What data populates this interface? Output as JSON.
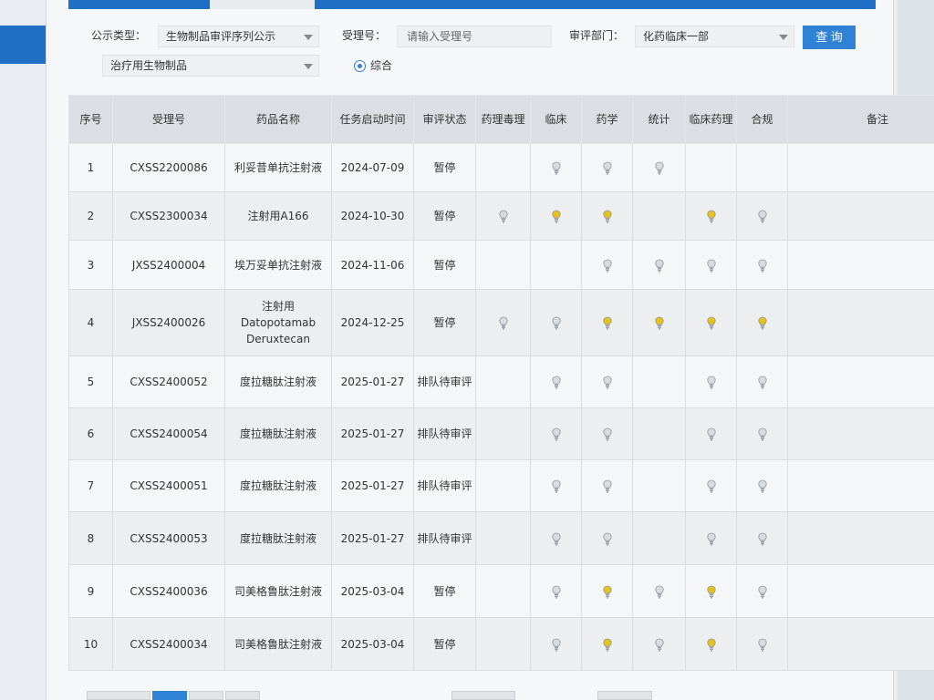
{
  "filters": {
    "type_label": "公示类型：",
    "type_value": "生物制品审评序列公示",
    "accept_label": "受理号：",
    "accept_placeholder": "请输入受理号",
    "dept_label": "审评部门：",
    "dept_value": "化药临床一部",
    "query_button": "查 询",
    "category_value": "治疗用生物制品",
    "radio_label": "综合"
  },
  "table": {
    "headers": [
      "序号",
      "受理号",
      "药品名称",
      "任务启动时间",
      "审评状态",
      "药理毒理",
      "临床",
      "药学",
      "统计",
      "临床药理",
      "合规",
      "备注"
    ],
    "rows": [
      {
        "no": "1",
        "id": "CXSS2200086",
        "name": "利妥昔单抗注射液",
        "date": "2024-07-09",
        "status": "暂停",
        "cells": [
          "",
          "off",
          "off",
          "off",
          "",
          "",
          ""
        ]
      },
      {
        "no": "2",
        "id": "CXSS2300034",
        "name": "注射用A166",
        "date": "2024-10-30",
        "status": "暂停",
        "cells": [
          "off",
          "on",
          "on",
          "",
          "on",
          "off",
          ""
        ]
      },
      {
        "no": "3",
        "id": "JXSS2400004",
        "name": "埃万妥单抗注射液",
        "date": "2024-11-06",
        "status": "暂停",
        "cells": [
          "",
          "",
          "off",
          "off",
          "off",
          "off",
          ""
        ]
      },
      {
        "no": "4",
        "id": "JXSS2400026",
        "name": "注射用 Datopotamab Deruxtecan",
        "date": "2024-12-25",
        "status": "暂停",
        "cells": [
          "off",
          "off",
          "on",
          "on",
          "on",
          "on",
          ""
        ]
      },
      {
        "no": "5",
        "id": "CXSS2400052",
        "name": "度拉糖肽注射液",
        "date": "2025-01-27",
        "status": "排队待审评",
        "cells": [
          "",
          "off",
          "off",
          "",
          "off",
          "off",
          ""
        ]
      },
      {
        "no": "6",
        "id": "CXSS2400054",
        "name": "度拉糖肽注射液",
        "date": "2025-01-27",
        "status": "排队待审评",
        "cells": [
          "",
          "off",
          "off",
          "",
          "off",
          "off",
          ""
        ]
      },
      {
        "no": "7",
        "id": "CXSS2400051",
        "name": "度拉糖肽注射液",
        "date": "2025-01-27",
        "status": "排队待审评",
        "cells": [
          "",
          "off",
          "off",
          "",
          "off",
          "off",
          ""
        ]
      },
      {
        "no": "8",
        "id": "CXSS2400053",
        "name": "度拉糖肽注射液",
        "date": "2025-01-27",
        "status": "排队待审评",
        "cells": [
          "",
          "off",
          "off",
          "",
          "off",
          "off",
          ""
        ]
      },
      {
        "no": "9",
        "id": "CXSS2400036",
        "name": "司美格鲁肽注射液",
        "date": "2025-03-04",
        "status": "暂停",
        "cells": [
          "",
          "off",
          "on",
          "off",
          "on",
          "off",
          ""
        ]
      },
      {
        "no": "10",
        "id": "CXSS2400034",
        "name": "司美格鲁肽注射液",
        "date": "2025-03-04",
        "status": "暂停",
        "cells": [
          "",
          "off",
          "on",
          "off",
          "on",
          "off",
          ""
        ]
      }
    ],
    "bulb_colors": {
      "on": "#e8c21c",
      "off": "#d9dcdf"
    }
  }
}
